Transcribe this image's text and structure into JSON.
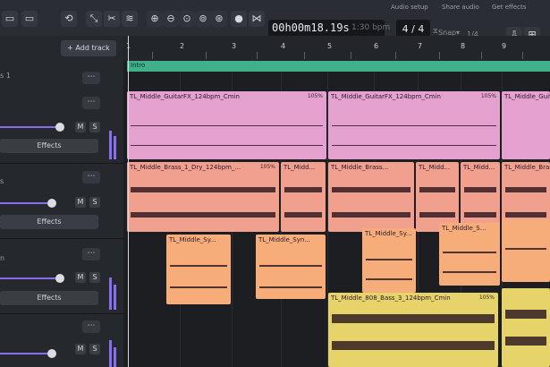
{
  "toolbar": {
    "time": "00h00m18.19s",
    "time_secondary": "1:30 bpm",
    "meter": "4 / 4",
    "snap_label": "Snap",
    "snap_value": "1/4",
    "audio_setup": "Audio setup",
    "share_audio": "Share audio",
    "get_effects": "Get effects"
  },
  "add_track": "+ Add track",
  "tracks": [
    {
      "label": "s 1",
      "effects": "Effects",
      "m": "M",
      "s": "S"
    },
    {
      "label": "s",
      "effects": "Effects",
      "m": "M",
      "s": "S"
    },
    {
      "label": "n",
      "effects": "Effects",
      "m": "M",
      "s": "S"
    },
    {
      "label": "",
      "effects": "",
      "m": "M",
      "s": "S"
    }
  ],
  "ruler": [
    "1",
    "2",
    "3",
    "4",
    "5",
    "6",
    "7",
    "8",
    "9"
  ],
  "section": "Intro",
  "clips": {
    "guitar1": "TL_Middle_GuitarFX_124bpm_Cmin",
    "guitar2": "TL_Middle_GuitarFX_124bpm_Cmin",
    "guitar3": "TL_Middle_GuitarFX_...",
    "brass1": "TL_Middle_Brass_1_Dry_124bpm_...",
    "brass2": "TL_Midd...",
    "brass3": "TL_Middle_Brass...",
    "brass4": "TL_Midd...",
    "brass5": "TL_Midd...",
    "brass6": "TL_Middle_Brass",
    "synth1": "TL_Middle_Sy...",
    "synth2": "TL_Middle_Syn...",
    "synth3": "TL_Middle_Sy...",
    "synth4": "TL_Middle_S...",
    "bass1": "TL_Middle_808_Bass_3_124bpm_Cmin",
    "pct": "105%"
  }
}
